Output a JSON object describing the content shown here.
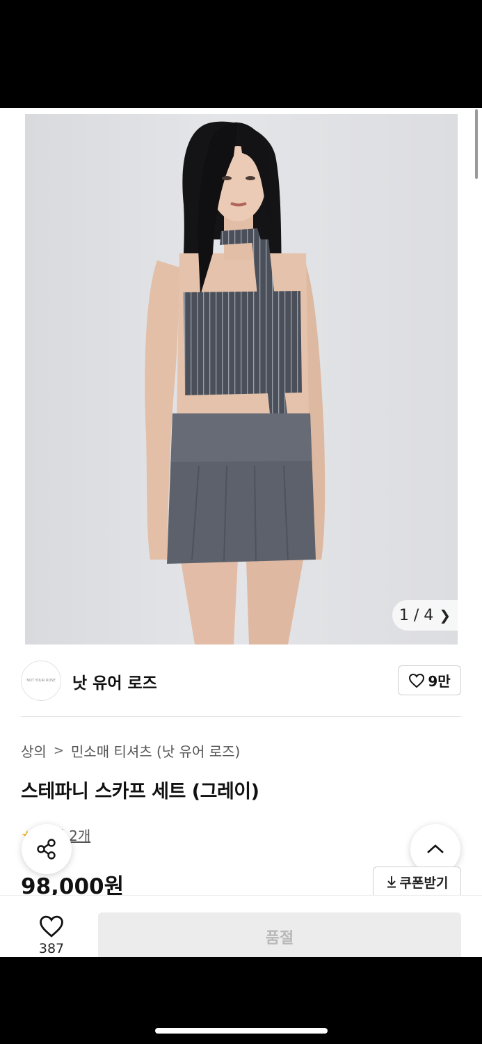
{
  "gallery": {
    "pager_text": "1 / 4",
    "next_icon": "chevron-right-icon"
  },
  "brand": {
    "logo_text": "NOT YOUR ROSE",
    "name": "낫 유어 로즈",
    "like_count": "9만",
    "like_icon": "heart-outline-icon"
  },
  "breadcrumb": {
    "category": "상의",
    "separator": ">",
    "subcategory": "민소매 티셔츠 (낫 유어 로즈)"
  },
  "product": {
    "title": "스테파니 스카프 세트 (그레이)",
    "review_label": "후기 2개",
    "price": "98,000원"
  },
  "coupon": {
    "label": "쿠폰받기",
    "icon": "download-icon"
  },
  "floating": {
    "share_icon": "share-icon",
    "scroll_top_icon": "chevron-up-icon"
  },
  "bottom_bar": {
    "wish_count": "387",
    "buy_label": "품절"
  },
  "colors": {
    "text": "#111111",
    "muted": "#555555",
    "soldout_bg": "#ececec",
    "soldout_text": "#b8b8b8",
    "star": "#f3b92b"
  }
}
